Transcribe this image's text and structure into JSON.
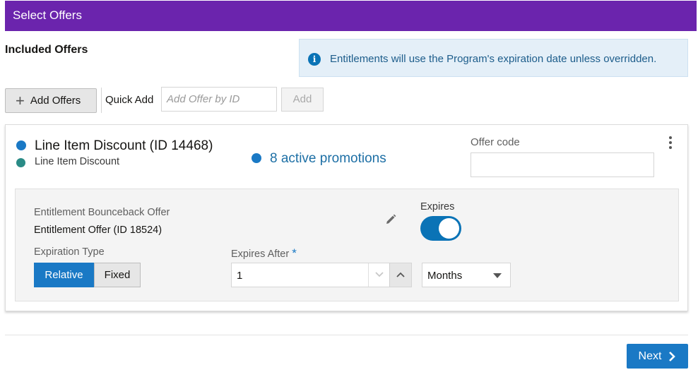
{
  "header": {
    "title": "Select Offers",
    "color": "#6b24ad"
  },
  "included_offers": {
    "title": "Included Offers"
  },
  "info_banner": {
    "icon": "info-icon",
    "text": "Entitlements will use the Program's expiration date unless overridden."
  },
  "toolbar": {
    "add_offers_label": "Add Offers",
    "quick_add_label": "Quick Add",
    "quick_add_placeholder": "Add Offer by ID",
    "add_label": "Add"
  },
  "offer_card": {
    "name": "Line Item Discount (ID 14468)",
    "subtitle": "Line Item Discount",
    "promotions": "8 active promotions",
    "offer_code_label": "Offer code",
    "offer_code_value": "",
    "status_colors": {
      "primary": "#1a79c5",
      "secondary": "#2a8b86",
      "promotions": "#1a79c5"
    },
    "entitlement": {
      "bounceback_label": "Entitlement Bounceback Offer",
      "bounceback_value": "Entitlement Offer (ID 18524)",
      "expires_label": "Expires",
      "expires_on": true,
      "expiration_type_label": "Expiration Type",
      "expiration_types": [
        "Relative",
        "Fixed"
      ],
      "expiration_type_selected": "Relative",
      "expires_after_label": "Expires After",
      "required_marker": "*",
      "expires_after_value": "1",
      "unit_value": "Months"
    }
  },
  "footer": {
    "next_label": "Next"
  }
}
